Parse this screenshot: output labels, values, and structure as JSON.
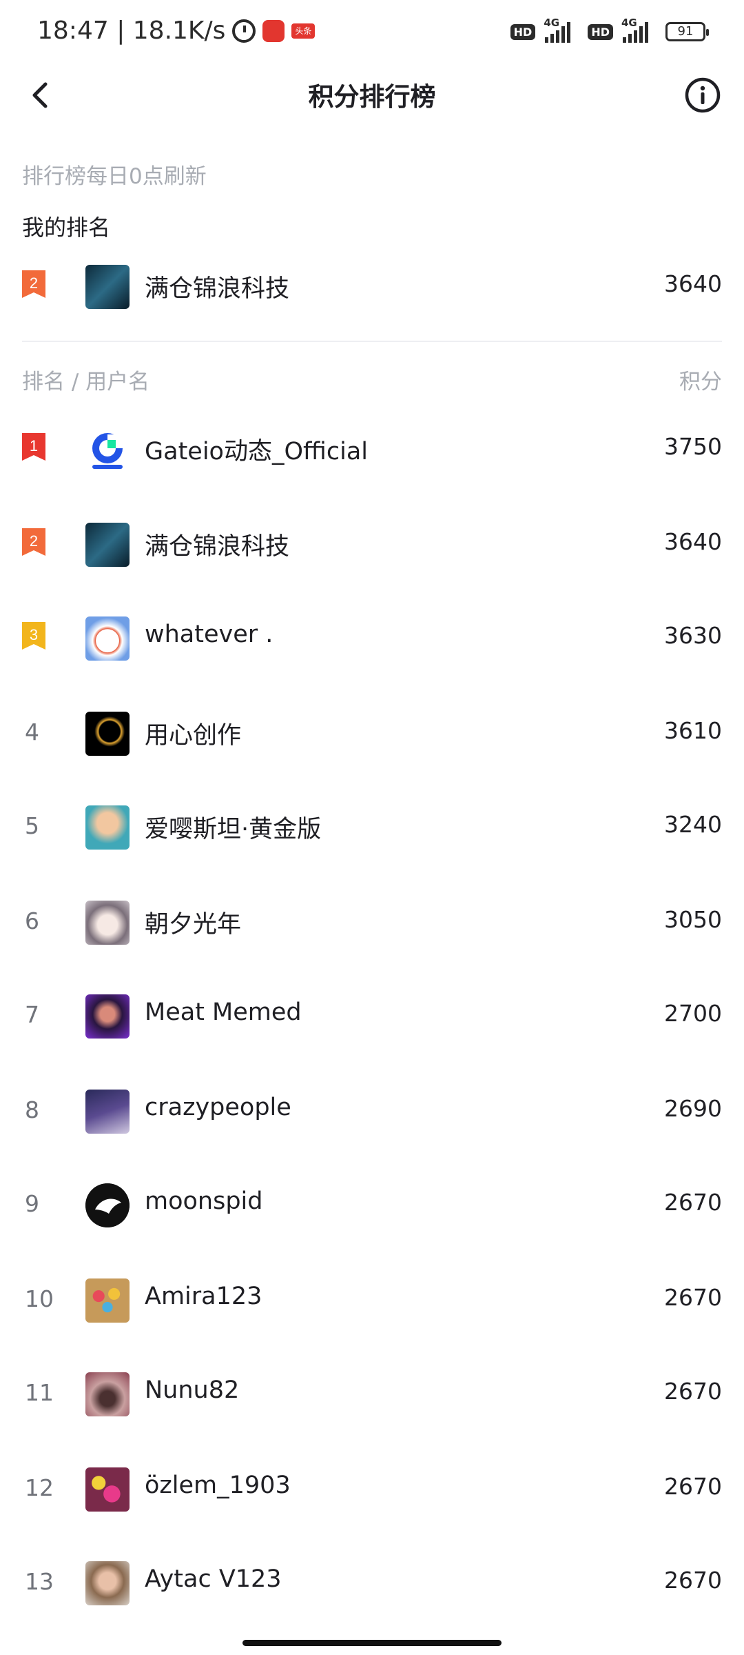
{
  "status_bar": {
    "time": "18:47 | 18.1K/s",
    "toutiao": "头条",
    "hd1": "HD",
    "net1": "4G",
    "hd2": "HD",
    "net2": "4G",
    "battery": "91"
  },
  "header": {
    "title": "积分排行榜",
    "back_icon": "chevron-left-icon",
    "info_icon": "info-circle-icon"
  },
  "refresh_note": "排行榜每日0点刷新",
  "my_rank": {
    "title": "我的排名",
    "rank": "2",
    "username": "满仓锦浪科技",
    "score": "3640"
  },
  "list_header": {
    "left": "排名 / 用户名",
    "right": "积分"
  },
  "colors": {
    "rank1": "#e8372f",
    "rank2": "#f26a3a",
    "rank3": "#f2b51c",
    "muted": "#a8acb3"
  },
  "leaderboard": [
    {
      "rank": "1",
      "username": "Gateio动态_Official",
      "score": "3750"
    },
    {
      "rank": "2",
      "username": "满仓锦浪科技",
      "score": "3640"
    },
    {
      "rank": "3",
      "username": "whatever .",
      "score": "3630"
    },
    {
      "rank": "4",
      "username": "用心创作",
      "score": "3610"
    },
    {
      "rank": "5",
      "username": "爱嘤斯坦·黄金版",
      "score": "3240"
    },
    {
      "rank": "6",
      "username": "朝夕光年",
      "score": "3050"
    },
    {
      "rank": "7",
      "username": "Meat Memed",
      "score": "2700"
    },
    {
      "rank": "8",
      "username": "crazypeople",
      "score": "2690"
    },
    {
      "rank": "9",
      "username": "moonspid",
      "score": "2670"
    },
    {
      "rank": "10",
      "username": "Amira123",
      "score": "2670"
    },
    {
      "rank": "11",
      "username": "Nunu82",
      "score": "2670"
    },
    {
      "rank": "12",
      "username": "özlem_1903",
      "score": "2670"
    },
    {
      "rank": "13",
      "username": "Aytac V123",
      "score": "2670"
    }
  ]
}
